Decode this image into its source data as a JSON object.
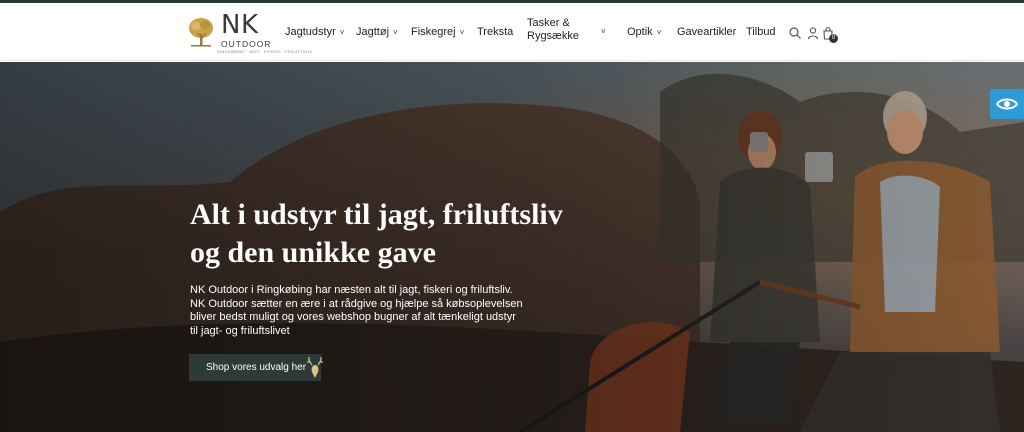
{
  "logo": {
    "main": "NK",
    "sub": "OUTDOOR",
    "tagline": "RINGKØBING · JAGT · FISKERI · FRILUFTSLIV"
  },
  "nav": {
    "items": [
      {
        "label": "Jagtudstyr",
        "has_dropdown": true
      },
      {
        "label": "Jagttøj",
        "has_dropdown": true
      },
      {
        "label": "Fiskegrej",
        "has_dropdown": true
      },
      {
        "label": "Treksta",
        "has_dropdown": false
      },
      {
        "label_line1": "Tasker &",
        "label_line2": "Rygsække",
        "has_dropdown": true
      },
      {
        "label": "Optik",
        "has_dropdown": true
      },
      {
        "label": "Gaveartikler",
        "has_dropdown": false
      },
      {
        "label": "Tilbud",
        "has_dropdown": false
      }
    ],
    "chevron": "˅"
  },
  "header_icons": {
    "search": "search-icon",
    "account": "user-icon",
    "cart": "shopping-bag-icon",
    "cart_count": "0"
  },
  "hero": {
    "title_line1": "Alt i udstyr til jagt, friluftsliv",
    "title_line2": "og den unikke gave",
    "text_line1": "NK Outdoor i Ringkøbing har næsten alt til jagt, fiskeri og friluftsliv.",
    "text_line2": "NK Outdoor sætter en ære i at rådgive og hjælpe så købsoplevelsen",
    "text_line3": "bliver bedst muligt og vores webshop bugner af alt tænkeligt udstyr",
    "text_line4": "til jagt- og friluftslivet",
    "cta_label": "Shop vores udvalg her"
  },
  "accessibility": {
    "icon": "eye-icon"
  },
  "colors": {
    "primary_dark": "#2d3a35",
    "accessibility_blue": "#2f9bd6",
    "logo_gold": "#c8a24a"
  }
}
